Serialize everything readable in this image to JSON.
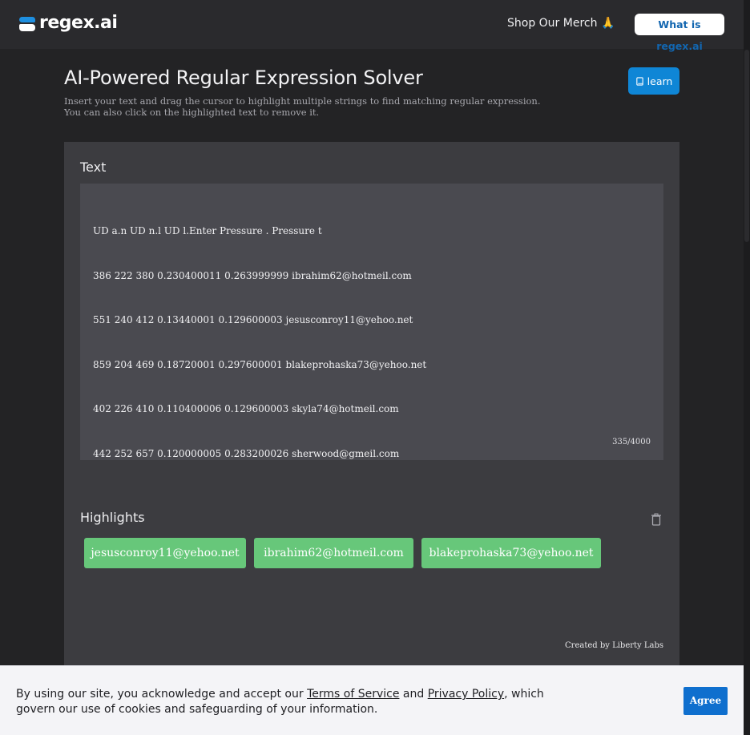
{
  "header": {
    "logo_text": "regex.ai",
    "merch_label": "Shop Our Merch",
    "merch_emoji": "🙏",
    "what_label": "What is regex.ai"
  },
  "main": {
    "title": "AI-Powered Regular Expression Solver",
    "subtitle_line1": "Insert your text and drag the cursor to highlight multiple strings to find matching regular expression.",
    "subtitle_line2": "You can also click on the highlighted text to remove it.",
    "learn_label": "learn"
  },
  "text_section": {
    "label": "Text",
    "lines": [
      "UD a.n UD n.l UD l.Enter Pressure . Pressure t",
      "386 222 380 0.230400011 0.263999999 ibrahim62@hotmeil.com",
      "551 240 412 0.13440001 0.129600003 jesusconroy11@yehoo.net",
      "859 204 469 0.18720001 0.297600001 blakeprohaska73@yehoo.net",
      "402 226 410 0.110400006 0.129600003 skyla74@hotmeil.com",
      "442 252 657 0.120000005 0.283200026 sherwood@gmeil.com"
    ],
    "char_count": "335/4000"
  },
  "highlights": {
    "label": "Highlights",
    "chips": [
      "jesusconroy11@yehoo.net",
      "ibrahim62@hotmeil.com",
      "blakeprohaska73@yehoo.net"
    ]
  },
  "footer": {
    "credit": "Created by Liberty Labs"
  },
  "cookie": {
    "text_before": "By using our site, you acknowledge and accept our ",
    "terms_link": "Terms of Service",
    "text_and": " and ",
    "privacy_link": "Privacy Policy",
    "text_after": ", which govern our use of cookies and safeguarding of your information.",
    "agree_label": "Agree"
  },
  "colors": {
    "accent": "#0f86d6",
    "chip": "#67c77a",
    "panel": "#3c3c40",
    "background": "#232325"
  }
}
